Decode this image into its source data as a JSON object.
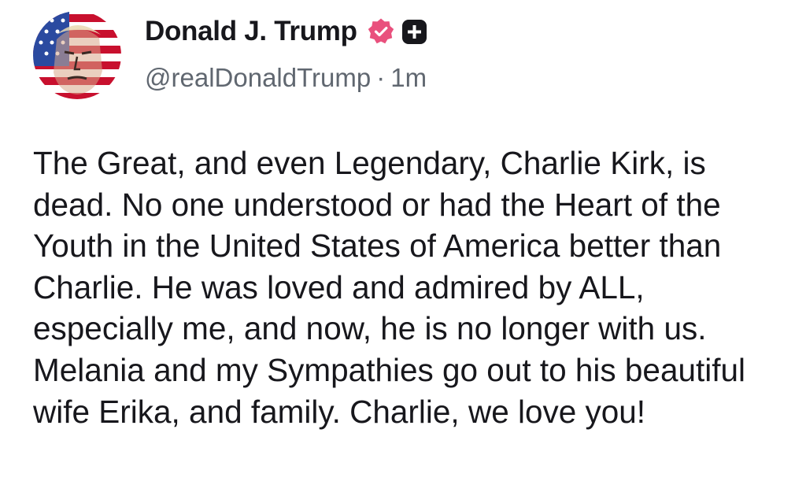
{
  "post": {
    "display_name": "Donald J. Trump",
    "handle": "@realDonaldTrump",
    "separator": "·",
    "timestamp": "1m",
    "body": "The Great, and even Legendary, Charlie Kirk, is dead. No one understood or had the Heart of the Youth in the United States of America better than Charlie. He was loved and admired by ALL, especially me, and now, he is no longer with us. Melania and my Sympathies go out to his beautiful wife Erika, and family. Charlie, we love you!"
  },
  "icons": {
    "avatar": "avatar-icon",
    "verified": "verified-badge-icon",
    "plus": "plus-badge-icon"
  },
  "colors": {
    "text": "#17171c",
    "muted": "#606770",
    "verified_badge": "#e9507d",
    "plus_badge": "#17171c",
    "background": "#ffffff"
  }
}
